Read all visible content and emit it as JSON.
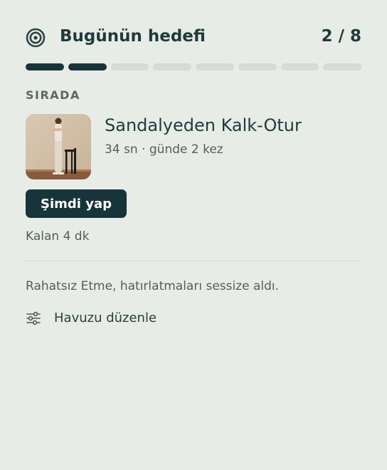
{
  "header": {
    "icon": "target-icon",
    "title": "Bugünün hedefi",
    "count": "2 / 8"
  },
  "progress": {
    "completed": 2,
    "total": 8,
    "fill_color": "#17343a",
    "track_color": "#d6dbd4"
  },
  "queue": {
    "section_label": "SIRADA",
    "exercise": {
      "title": "Sandalyeden Kalk-Otur",
      "meta": "34 sn · günde 2 kez",
      "thumbnail": "person-standing-beside-chair-photo"
    },
    "action_label": "Şimdi yap",
    "remaining": "Kalan 4 dk"
  },
  "notice": {
    "text": "Rahatsız Etme, hatırlatmaları sessize aldı."
  },
  "edit": {
    "icon": "sliders-icon",
    "label": "Havuzu düzenle"
  },
  "colors": {
    "background": "#e8ece6",
    "primary": "#17343a",
    "text": "#1e3b3c",
    "muted": "#52605d"
  }
}
